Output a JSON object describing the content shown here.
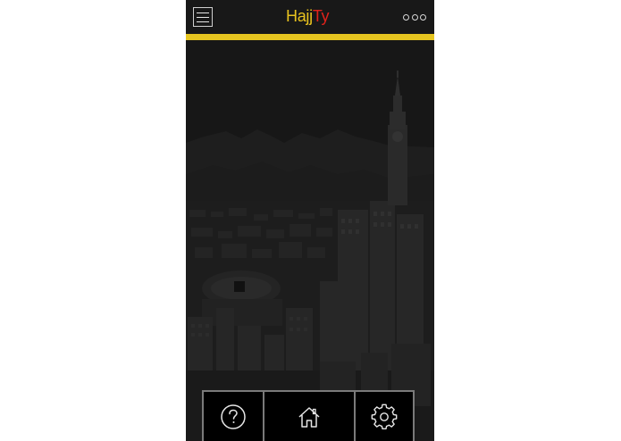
{
  "app": {
    "logo_part1": "Hajj",
    "logo_part2": "Ty",
    "accent_color": "#e6c520",
    "logo_colors": [
      "#e8c21f",
      "#e0221b"
    ]
  },
  "header": {
    "menu_icon": "hamburger-menu-icon",
    "more_icon": "more-options-icon"
  },
  "hero": {
    "description_icon": "city-skyline-background-image"
  },
  "tabbar": {
    "items": [
      {
        "icon": "question-mark-icon"
      },
      {
        "icon": "home-icon"
      },
      {
        "icon": "gear-icon"
      }
    ]
  }
}
